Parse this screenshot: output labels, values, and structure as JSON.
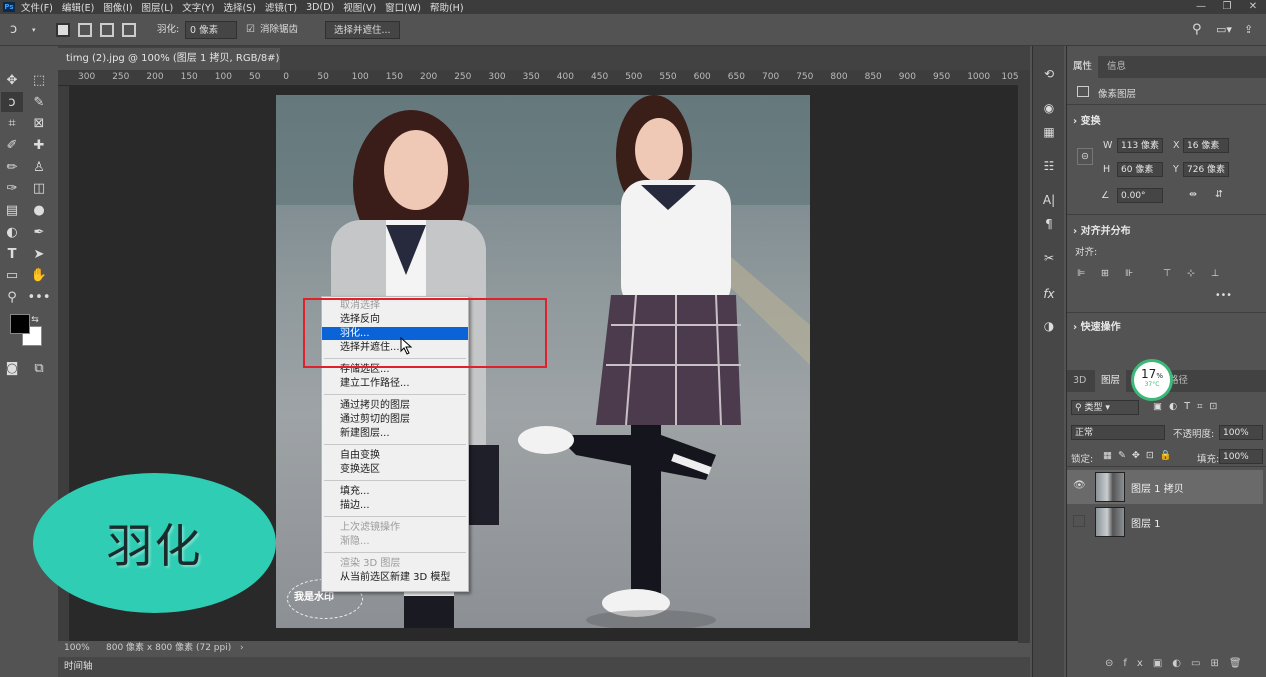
{
  "menubar": {
    "logo": "Ps",
    "items": [
      "文件(F)",
      "编辑(E)",
      "图像(I)",
      "图层(L)",
      "文字(Y)",
      "选择(S)",
      "滤镜(T)",
      "3D(D)",
      "视图(V)",
      "窗口(W)",
      "帮助(H)"
    ],
    "min": "—",
    "restore": "❐",
    "close": "✕"
  },
  "options": {
    "feather_label": "羽化:",
    "feather_value": "0 像素",
    "antialias_label": "消除锯齿",
    "select_mask_label": "选择并遮住..."
  },
  "document": {
    "tab_title": "timg (2).jpg @ 100% (图层 1 拷贝, RGB/8#) *",
    "close": "×",
    "ruler_ticks": [
      "300",
      "250",
      "200",
      "150",
      "100",
      "50",
      "0",
      "50",
      "100",
      "150",
      "200",
      "250",
      "300",
      "350",
      "400",
      "450",
      "500",
      "550",
      "600",
      "650",
      "700",
      "750",
      "800",
      "850",
      "900",
      "950",
      "1000",
      "1050"
    ],
    "zoom": "100%",
    "size_info": "800 像素 x 800 像素 (72 ppi)",
    "arrow": "›"
  },
  "context_menu": {
    "items": [
      {
        "label": "取消选择",
        "disabled": true
      },
      {
        "label": "选择反向",
        "disabled": false
      },
      {
        "label": "羽化...",
        "disabled": false,
        "highlight": true
      },
      {
        "label": "选择并遮住...",
        "disabled": false
      },
      {
        "sep": true
      },
      {
        "label": "存储选区...",
        "disabled": false
      },
      {
        "label": "建立工作路径...",
        "disabled": false
      },
      {
        "sep": true
      },
      {
        "label": "通过拷贝的图层",
        "disabled": false
      },
      {
        "label": "通过剪切的图层",
        "disabled": false
      },
      {
        "label": "新建图层...",
        "disabled": false
      },
      {
        "sep": true
      },
      {
        "label": "自由变换",
        "disabled": false
      },
      {
        "label": "变换选区",
        "disabled": false
      },
      {
        "sep": true
      },
      {
        "label": "填充...",
        "disabled": false
      },
      {
        "label": "描边...",
        "disabled": false
      },
      {
        "sep": true
      },
      {
        "label": "上次滤镜操作",
        "disabled": true
      },
      {
        "label": "渐隐...",
        "disabled": true
      },
      {
        "sep": true
      },
      {
        "label": "渲染 3D 图层",
        "disabled": true
      },
      {
        "label": "从当前选区新建 3D 模型",
        "disabled": false
      }
    ]
  },
  "overlay": {
    "ellipse_text": "羽化",
    "watermark_text": "我是水印"
  },
  "timeline": {
    "label": "时间轴"
  },
  "properties": {
    "tabs": [
      "属性",
      "信息"
    ],
    "layer_type": "像素图层",
    "transform_title": "变换",
    "w_label": "W",
    "w_value": "113 像素",
    "x_label": "X",
    "x_value": "16 像素",
    "h_label": "H",
    "h_value": "60 像素",
    "y_label": "Y",
    "y_value": "726 像素",
    "angle_value": "0.00°",
    "align_title": "对齐并分布",
    "align_label": "对齐:",
    "quick_title": "快速操作",
    "more": "•••"
  },
  "layers": {
    "tabs": [
      "3D",
      "图层",
      "通道",
      "路径"
    ],
    "filter_label": "类型",
    "blend_mode": "正常",
    "opacity_label": "不透明度:",
    "opacity_value": "100%",
    "lock_label": "锁定:",
    "fill_label": "填充:",
    "fill_value": "100%",
    "items": [
      {
        "name": "图层 1 拷贝",
        "visible": true,
        "selected": true
      },
      {
        "name": "图层 1",
        "visible": false,
        "selected": false
      }
    ]
  },
  "badge": {
    "percent": "17",
    "unit": "%",
    "temp": "37°C"
  }
}
